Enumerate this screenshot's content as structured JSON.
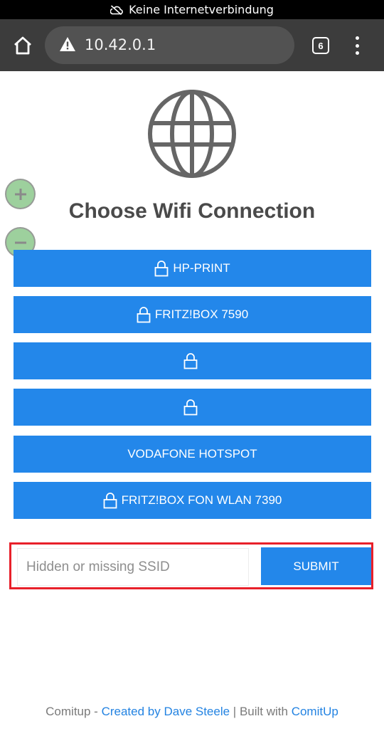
{
  "status_bar": {
    "text": "Keine Internetverbindung",
    "icon": "cloud-off-icon"
  },
  "browser": {
    "url": "10.42.0.1",
    "tab_count": "6",
    "colors": {
      "toolbar": "#3c3c3c",
      "url_bar": "#525252"
    }
  },
  "page": {
    "title": "Choose Wifi Connection",
    "networks": [
      {
        "ssid": "HP-PRINT",
        "secured": true
      },
      {
        "ssid": "FRITZ!BOX 7590",
        "secured": true
      },
      {
        "ssid": "",
        "secured": true
      },
      {
        "ssid": "",
        "secured": true
      },
      {
        "ssid": "VODAFONE HOTSPOT",
        "secured": false
      },
      {
        "ssid": "FRITZ!BOX FON WLAN 7390",
        "secured": true
      }
    ],
    "hidden_ssid": {
      "placeholder": "Hidden or missing SSID",
      "value": ""
    },
    "submit_label": "SUBMIT",
    "colors": {
      "accent": "#2387ea",
      "highlight_border": "#e8202a"
    }
  },
  "footer": {
    "prefix": "Comitup - ",
    "created_link": "Created by Dave Steele",
    "separator": " | Built with ",
    "built_link": "ComitUp"
  }
}
